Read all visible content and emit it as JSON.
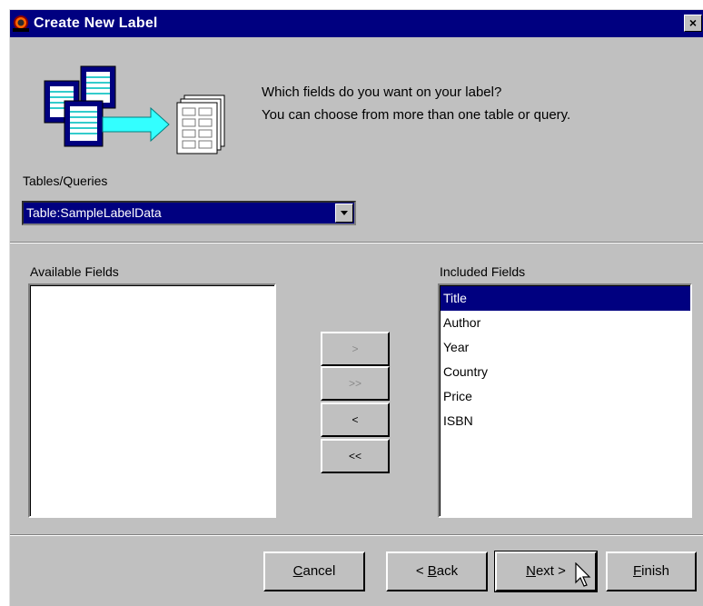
{
  "window": {
    "title": "Create New Label",
    "close_glyph": "×",
    "icon": "app-logo-icon"
  },
  "header": {
    "illustration": "tables-to-label-illustration",
    "question_line1": "Which fields do you want on your label?",
    "question_line2": "You can choose from more than one table or query."
  },
  "tables": {
    "label": "Tables/Queries",
    "selected": "Table:SampleLabelData"
  },
  "available": {
    "label": "Available Fields",
    "items": []
  },
  "included": {
    "label": "Included Fields",
    "items": [
      "Title",
      "Author",
      "Year",
      "Country",
      "Price",
      "ISBN"
    ],
    "selected_index": 0
  },
  "move_buttons": {
    "add": ">",
    "add_all": ">>",
    "remove": "<",
    "remove_all": "<<"
  },
  "footer": {
    "cancel": {
      "pre": "",
      "key": "C",
      "post": "ancel"
    },
    "back": {
      "pre": "< ",
      "key": "B",
      "post": "ack"
    },
    "next": {
      "pre": "",
      "key": "N",
      "post": "ext >"
    },
    "finish": {
      "pre": "",
      "key": "F",
      "post": "inish"
    }
  },
  "colors": {
    "title_bar": "#000080",
    "face": "#c0c0c0",
    "selection": "#000080"
  }
}
